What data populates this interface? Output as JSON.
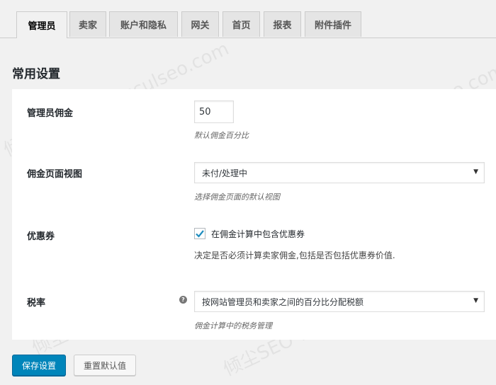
{
  "tabs": [
    {
      "label": "管理员",
      "active": true
    },
    {
      "label": "卖家",
      "active": false
    },
    {
      "label": "账户和隐私",
      "active": false
    },
    {
      "label": "网关",
      "active": false
    },
    {
      "label": "首页",
      "active": false
    },
    {
      "label": "报表",
      "active": false
    },
    {
      "label": "附件插件",
      "active": false
    }
  ],
  "section_title": "常用设置",
  "settings": {
    "commission": {
      "label": "管理员佣金",
      "value": "50",
      "description": "默认佣金百分比"
    },
    "commission_view": {
      "label": "佣金页面视图",
      "selected": "未付/处理中",
      "description": "选择佣金页面的默认视图"
    },
    "coupon": {
      "label": "优惠券",
      "checked": true,
      "checkbox_label": "在佣金计算中包含优惠券",
      "description": "决定是否必须计算卖家佣金,包括是否包括优惠券价值."
    },
    "tax": {
      "label": "税率",
      "selected": "按网站管理员和卖家之间的百分比分配税额",
      "description": "佣金计算中的税务管理"
    }
  },
  "buttons": {
    "save": "保存设置",
    "reset": "重置默认值"
  },
  "watermark_text": "倾尘SEO www.qculseo.com",
  "colors": {
    "primary": "#0085ba",
    "background": "#f1f1f1",
    "panel": "#ffffff"
  }
}
